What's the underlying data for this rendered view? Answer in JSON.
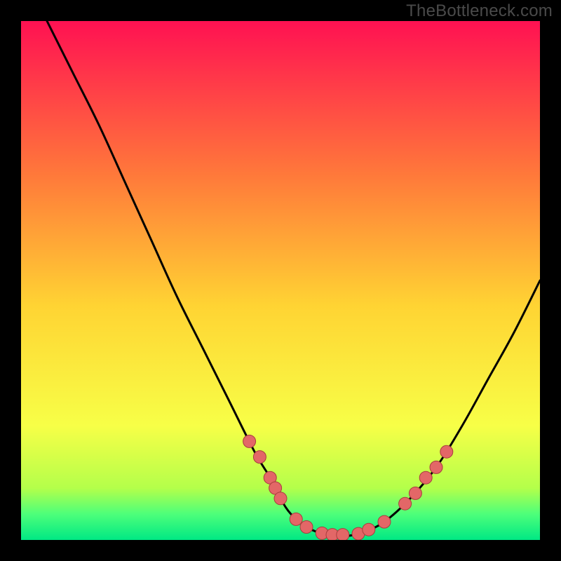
{
  "attribution": "TheBottleneck.com",
  "colors": {
    "bg": "#000000",
    "grad_top": "#ff1152",
    "grad_mid_upper": "#ff7a3a",
    "grad_mid": "#ffd433",
    "grad_lower": "#f7ff47",
    "grad_green1": "#b4ff4a",
    "grad_green2": "#4dff7a",
    "grad_green3": "#00e884",
    "curve": "#000000",
    "point": "#e36767",
    "point_stroke": "#a83d3d"
  },
  "chart_data": {
    "type": "line",
    "title": "",
    "xlabel": "",
    "ylabel": "",
    "xlim": [
      0,
      100
    ],
    "ylim": [
      0,
      100
    ],
    "series": [
      {
        "name": "bottleneck-curve",
        "x": [
          5,
          10,
          15,
          20,
          25,
          30,
          35,
          40,
          45,
          48,
          50,
          52,
          55,
          58,
          60,
          63,
          66,
          70,
          75,
          80,
          85,
          90,
          95,
          100
        ],
        "y": [
          100,
          90,
          80,
          69,
          58,
          47,
          37,
          27,
          17,
          12,
          8,
          5,
          2.5,
          1.2,
          0.8,
          0.8,
          1.5,
          3.5,
          8,
          14,
          22,
          31,
          40,
          50
        ]
      }
    ],
    "points": [
      {
        "x": 44,
        "y": 19
      },
      {
        "x": 46,
        "y": 16
      },
      {
        "x": 48,
        "y": 12
      },
      {
        "x": 49,
        "y": 10
      },
      {
        "x": 50,
        "y": 8
      },
      {
        "x": 53,
        "y": 4
      },
      {
        "x": 55,
        "y": 2.5
      },
      {
        "x": 58,
        "y": 1.3
      },
      {
        "x": 60,
        "y": 1
      },
      {
        "x": 62,
        "y": 1
      },
      {
        "x": 65,
        "y": 1.2
      },
      {
        "x": 67,
        "y": 2
      },
      {
        "x": 70,
        "y": 3.5
      },
      {
        "x": 74,
        "y": 7
      },
      {
        "x": 76,
        "y": 9
      },
      {
        "x": 78,
        "y": 12
      },
      {
        "x": 80,
        "y": 14
      },
      {
        "x": 82,
        "y": 17
      }
    ]
  }
}
